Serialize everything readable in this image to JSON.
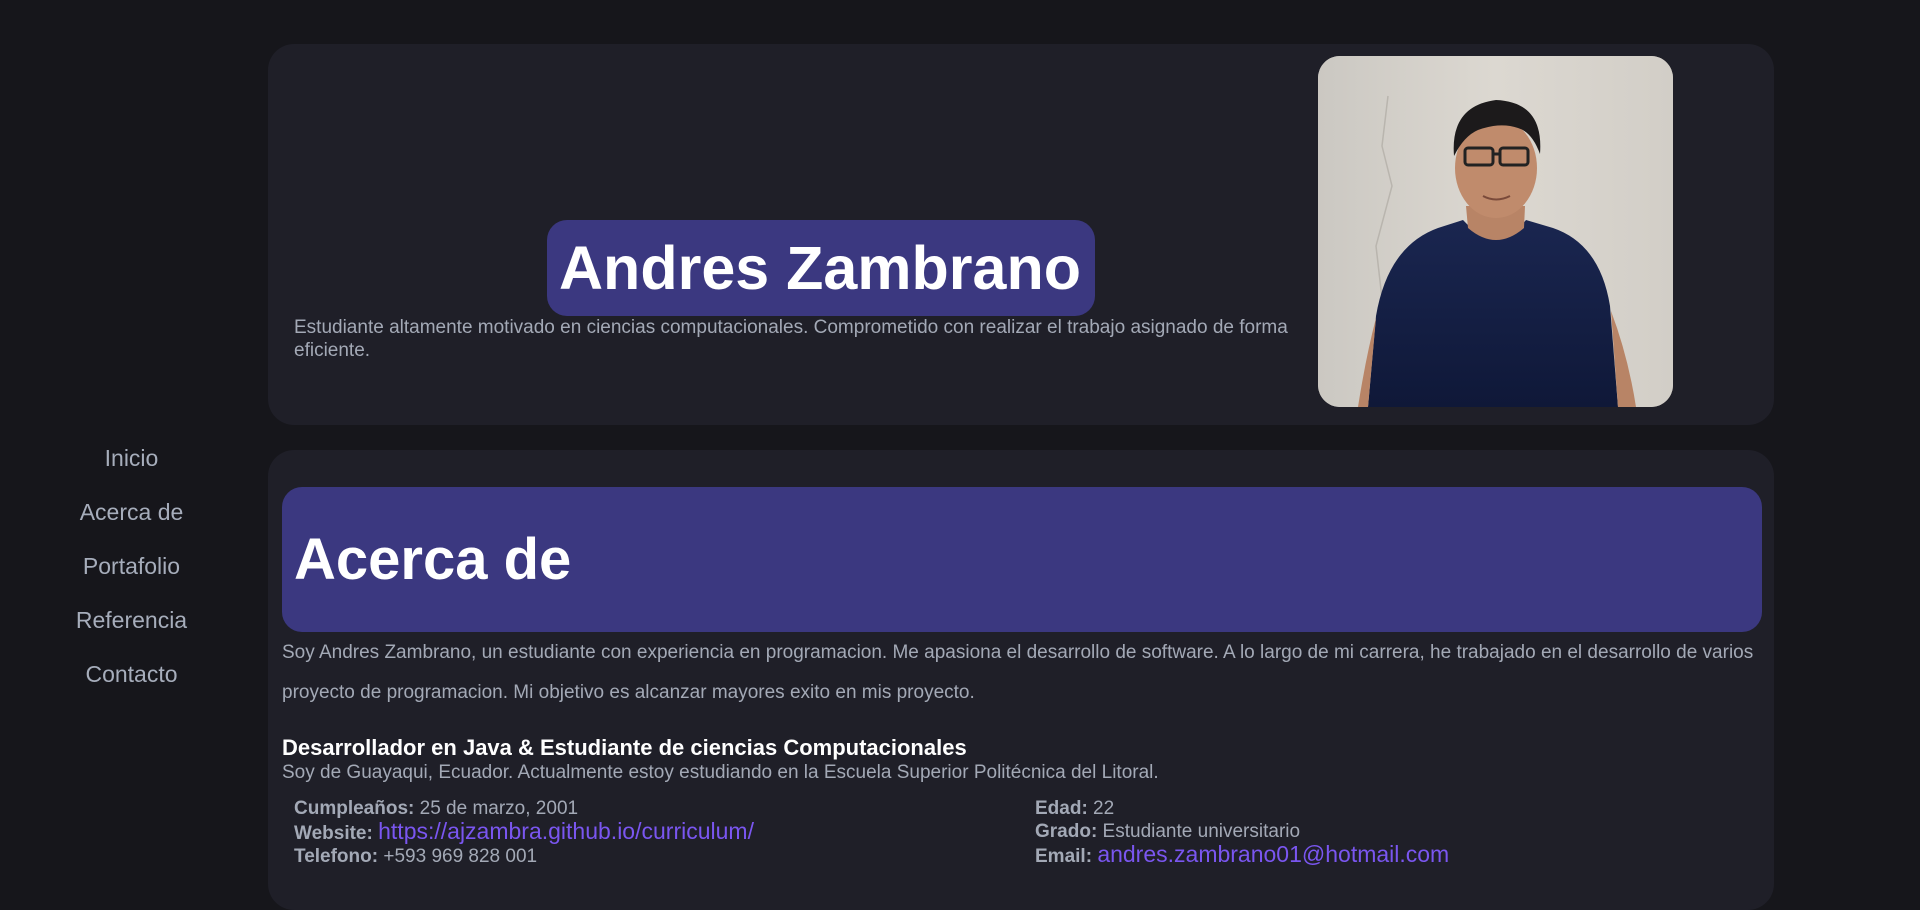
{
  "nav": {
    "items": [
      {
        "label": "Inicio"
      },
      {
        "label": "Acerca de"
      },
      {
        "label": "Portafolio"
      },
      {
        "label": "Referencia"
      },
      {
        "label": "Contacto"
      }
    ]
  },
  "hero": {
    "name": "Andres Zambrano",
    "description": "Estudiante altamente motivado en ciencias computacionales. Comprometido con realizar el trabajo asignado de forma eficiente."
  },
  "about": {
    "title": "Acerca de",
    "text": "Soy Andres Zambrano, un estudiante con experiencia en programacion. Me apasiona el desarrollo de software. A lo largo de mi carrera, he trabajado en el desarrollo de varios proyecto de programacion. Mi objetivo es alcanzar mayores exito en mis proyecto.",
    "role_title": "Desarrollador en Java & Estudiante de ciencias Computacionales",
    "role_description": "Soy de Guayaqui, Ecuador. Actualmente estoy estudiando en la Escuela Superior Politécnica del Litoral.",
    "info_left": [
      {
        "key": "Cumpleaños:",
        "value": " 25 de marzo, 2001"
      },
      {
        "key": "Website:",
        "value": "https://ajzambra.github.io/curriculum/"
      },
      {
        "key": "Telefono:",
        "value": " +593 969 828 001"
      }
    ],
    "info_right": [
      {
        "key": "Edad:",
        "value": " 22"
      },
      {
        "key": "Grado:",
        "value": " Estudiante universitario"
      },
      {
        "key": "Email:",
        "value": "andres.zambrano01@hotmail.com"
      }
    ]
  },
  "colors": {
    "background": "#16161b",
    "card": "#1f1f28",
    "accent": "#3b3880",
    "link": "#7a56f0"
  }
}
